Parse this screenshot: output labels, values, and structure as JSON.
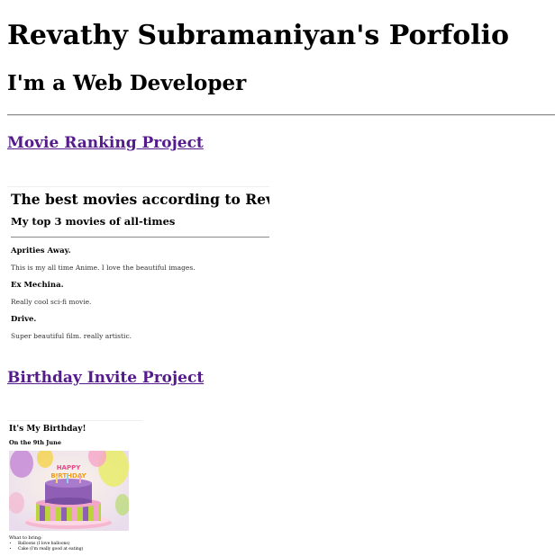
{
  "header": {
    "title": "Revathy Subramaniyan's Porfolio",
    "subtitle": "I'm a Web Developer"
  },
  "projects": [
    {
      "link_label": "Movie Ranking Project",
      "preview": {
        "heading": "The best movies according to Revathy",
        "subheading": "My top 3 movies of all-times",
        "movies": [
          {
            "title": "Aprities Away.",
            "description": "This is my all time Anime. I love the beautiful images."
          },
          {
            "title": "Ex Mechina.",
            "description": "Really cool sci-fi movie."
          },
          {
            "title": "Drive.",
            "description": "Super beautiful film. really artistic."
          }
        ]
      }
    },
    {
      "link_label": "Birthday Invite Project",
      "preview": {
        "heading": "It's My Birthday!",
        "subheading": "On the 9th June",
        "image_alt": "birthday-cake-image",
        "bring_label": "What to bring:",
        "bring_items": [
          "Balloons (I love balloons)",
          "Cake (I'm really good at eating)"
        ]
      }
    }
  ],
  "colors": {
    "visited_link": "#551a8b",
    "rule": "#8a8a8a",
    "cake_top": "#8e5fb5",
    "cake_pink": "#f3a7c8",
    "cake_green": "#b9d53b"
  }
}
